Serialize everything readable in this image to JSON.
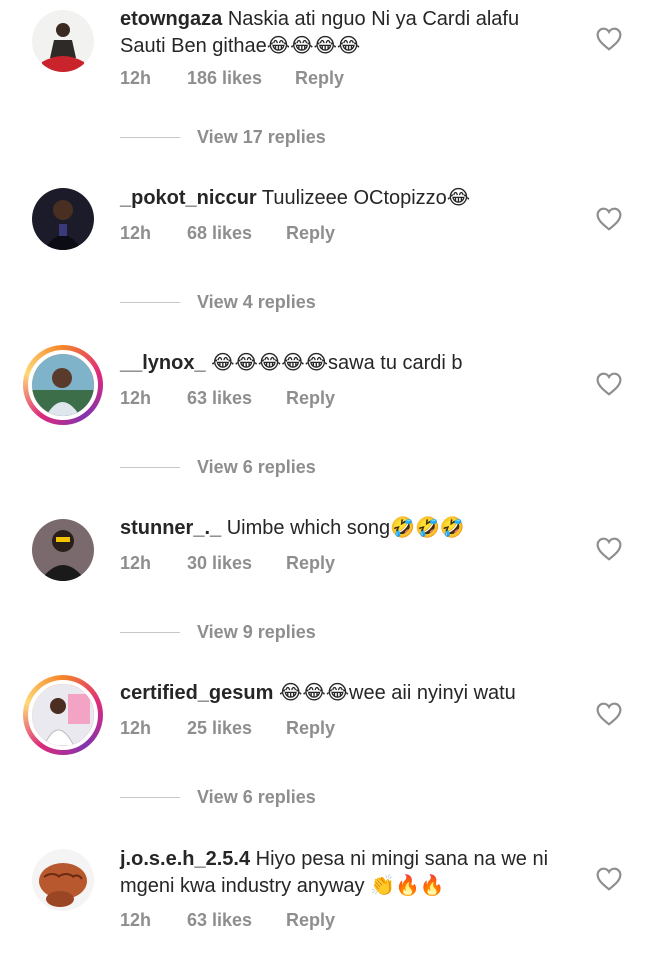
{
  "comments": [
    {
      "username": "etowngaza",
      "text": "Naskia ati nguo Ni ya Cardi alafu Sauti Ben githae😂😂😂😂",
      "time": "12h",
      "likes": "186 likes",
      "reply": "Reply",
      "view_replies": "View 17 replies"
    },
    {
      "username": "_pokot_niccur",
      "text": "Tuulizeee OCtopizzo😂",
      "time": "12h",
      "likes": "68 likes",
      "reply": "Reply",
      "view_replies": "View 4 replies"
    },
    {
      "username": "__lynox_",
      "text": "😂😂😂😂😂sawa tu cardi b",
      "time": "12h",
      "likes": "63 likes",
      "reply": "Reply",
      "view_replies": "View 6 replies"
    },
    {
      "username": "stunner_._",
      "text": "Uimbe which song🤣🤣🤣",
      "time": "12h",
      "likes": "30 likes",
      "reply": "Reply",
      "view_replies": "View 9 replies"
    },
    {
      "username": "certified_gesum",
      "text": "😂😂😂wee aii nyinyi watu",
      "time": "12h",
      "likes": "25 likes",
      "reply": "Reply",
      "view_replies": "View 6 replies"
    },
    {
      "username": "j.o.s.e.h_2.5.4",
      "text": "Hiyo pesa ni mingi sana na we ni mgeni kwa industry anyway 👏🔥🔥",
      "time": "12h",
      "likes": "63 likes",
      "reply": "Reply"
    }
  ]
}
